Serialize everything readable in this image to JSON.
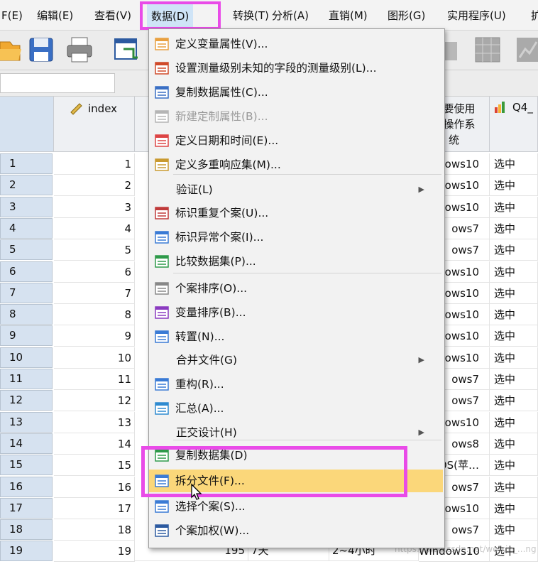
{
  "menubar": {
    "items": [
      "F(E)",
      "编辑(E)",
      "查看(V)",
      "数据(D)",
      "转换(T)",
      "分析(A)",
      "直销(M)",
      "图形(G)",
      "实用程序(U)",
      "扩"
    ]
  },
  "columns": {
    "index_header": "index",
    "os_header_lines": [
      "主要使用",
      "的操作系",
      "统"
    ],
    "q4_header": "Q4_"
  },
  "rows": [
    {
      "num": "1",
      "index": "1",
      "os": "ows10",
      "q4": "选中"
    },
    {
      "num": "2",
      "index": "2",
      "os": "ows10",
      "q4": "选中"
    },
    {
      "num": "3",
      "index": "3",
      "os": "ows10",
      "q4": "选中"
    },
    {
      "num": "4",
      "index": "4",
      "os": "ows7",
      "q4": "选中"
    },
    {
      "num": "5",
      "index": "5",
      "os": "ows7",
      "q4": "选中"
    },
    {
      "num": "6",
      "index": "6",
      "os": "ows10",
      "q4": "选中"
    },
    {
      "num": "7",
      "index": "7",
      "os": "ows10",
      "q4": "选中"
    },
    {
      "num": "8",
      "index": "8",
      "os": "ows10",
      "q4": "选中"
    },
    {
      "num": "9",
      "index": "9",
      "os": "ows10",
      "q4": "选中"
    },
    {
      "num": "10",
      "index": "10",
      "os": "ows10",
      "q4": "选中"
    },
    {
      "num": "11",
      "index": "11",
      "os": "ows7",
      "q4": "选中"
    },
    {
      "num": "12",
      "index": "12",
      "os": "ows7",
      "q4": "选中"
    },
    {
      "num": "13",
      "index": "13",
      "os": "ows10",
      "q4": "选中"
    },
    {
      "num": "14",
      "index": "14",
      "os": "ows8",
      "q4": "选中"
    },
    {
      "num": "15",
      "index": "15",
      "os": "OS(苹…",
      "q4": "选中"
    },
    {
      "num": "16",
      "index": "16",
      "os": "ows7",
      "q4": "选中"
    },
    {
      "num": "17",
      "index": "17",
      "os": "ows10",
      "q4": "选中"
    },
    {
      "num": "18",
      "index": "18",
      "os": "ows7",
      "q4": "选中"
    },
    {
      "num": "19",
      "index": "19",
      "os": "Windows10",
      "q4": "选中"
    }
  ],
  "last_row_extra": {
    "val": "195",
    "days": "7天",
    "hours": "2~4小时"
  },
  "dropdown": {
    "items": [
      {
        "label": "定义变量属性(V)...",
        "icon": "define-variable-properties-icon"
      },
      {
        "label": "设置测量级别未知的字段的测量级别(L)...",
        "icon": "measurement-level-icon"
      },
      {
        "label": "复制数据属性(C)...",
        "icon": "copy-data-properties-icon"
      },
      {
        "label": "新建定制属性(B)...",
        "icon": "new-custom-attribute-icon",
        "disabled": true
      },
      {
        "label": "定义日期和时间(E)...",
        "icon": "define-dates-icon"
      },
      {
        "label": "定义多重响应集(M)...",
        "icon": "multiple-response-sets-icon"
      },
      {
        "label": "验证(L)",
        "submenu": true
      },
      {
        "label": "标识重复个案(U)...",
        "icon": "identify-duplicate-cases-icon"
      },
      {
        "label": "标识异常个案(I)...",
        "icon": "identify-unusual-cases-icon"
      },
      {
        "label": "比较数据集(P)...",
        "icon": "compare-datasets-icon"
      },
      {
        "label": "个案排序(O)...",
        "icon": "sort-cases-icon"
      },
      {
        "label": "变量排序(B)...",
        "icon": "sort-variables-icon"
      },
      {
        "label": "转置(N)...",
        "icon": "transpose-icon"
      },
      {
        "label": "合并文件(G)",
        "submenu": true
      },
      {
        "label": "重构(R)...",
        "icon": "restructure-icon"
      },
      {
        "label": "汇总(A)...",
        "icon": "aggregate-icon"
      },
      {
        "label": "正交设计(H)",
        "submenu": true
      },
      {
        "label": "复制数据集(D)",
        "icon": "copy-dataset-icon"
      },
      {
        "label": "拆分文件(F)...",
        "icon": "split-file-icon",
        "highlighted": true
      },
      {
        "label": "选择个案(S)...",
        "icon": "select-cases-icon"
      },
      {
        "label": "个案加权(W)...",
        "icon": "weight-cases-icon"
      }
    ]
  },
  "watermark": "https://blog.csdn.net/weixin_...ng",
  "colors": {
    "highlight_box": "#e94be8",
    "menu_hover": "#fbd77a",
    "row_header": "#d6e2f0"
  }
}
